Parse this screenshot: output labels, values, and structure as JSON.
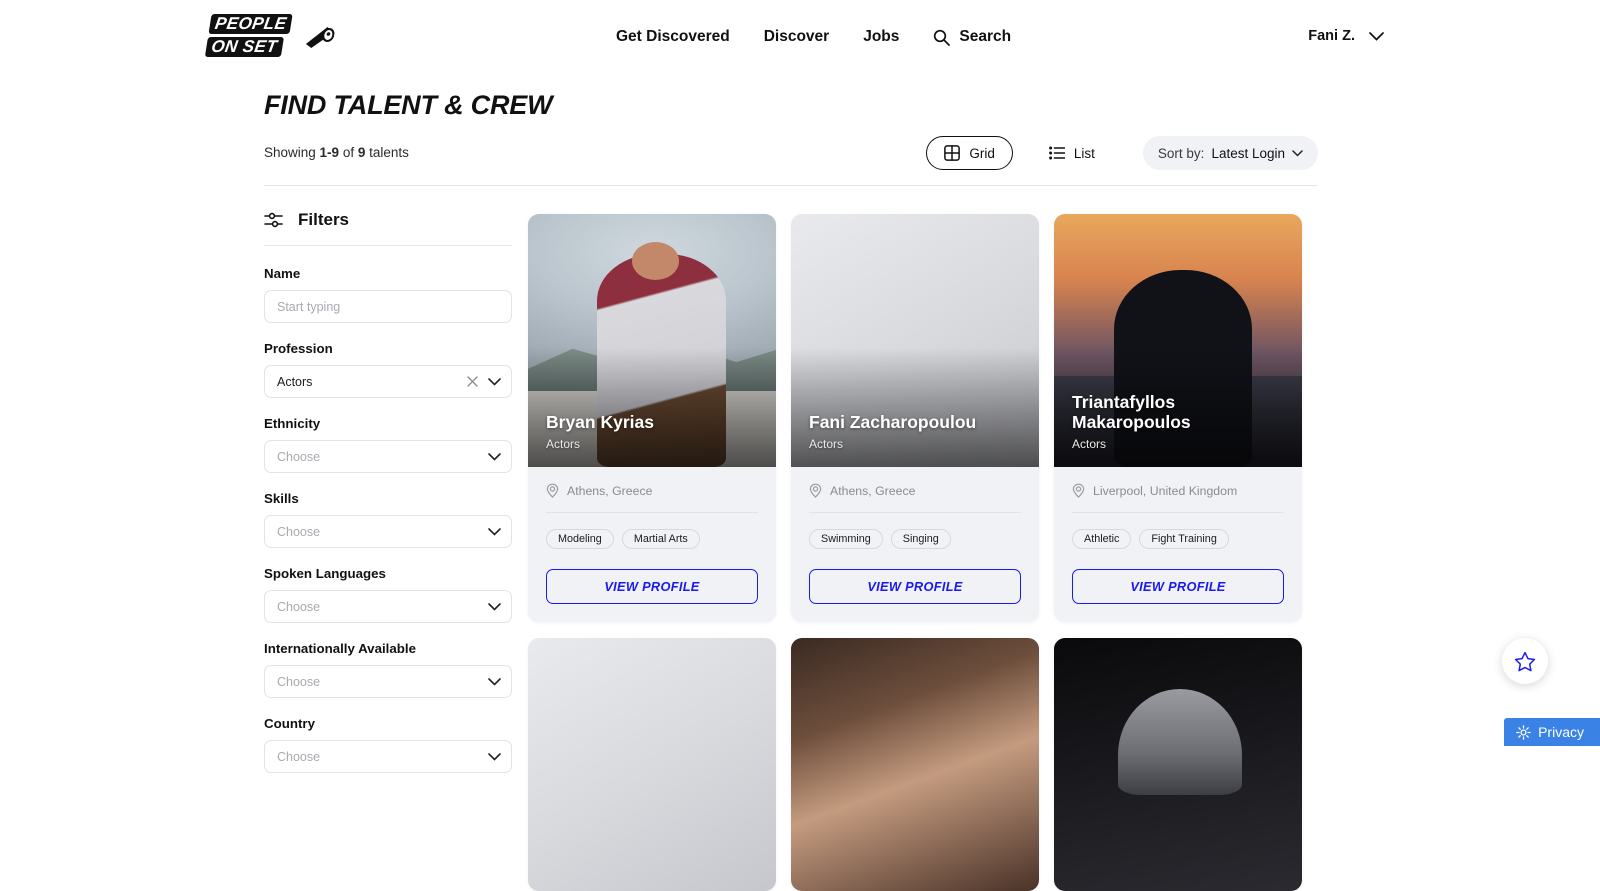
{
  "brand": {
    "logo_line1": "PEOPLE",
    "logo_line2": "ON SET",
    "camera_icon": "film-reel-icon"
  },
  "nav": {
    "items": [
      {
        "label": "Get Discovered"
      },
      {
        "label": "Discover"
      },
      {
        "label": "Jobs"
      }
    ],
    "search_label": "Search",
    "search_icon": "search-icon"
  },
  "user": {
    "name": "Fani Z.",
    "chevron_icon": "chevron-down-icon"
  },
  "page": {
    "title": "FIND TALENT & CREW"
  },
  "results": {
    "showing_prefix": "Showing ",
    "range": "1-9",
    "middle": " of ",
    "total": "9",
    "suffix": " talents"
  },
  "toolbar": {
    "grid_label": "Grid",
    "grid_icon": "grid-icon",
    "list_label": "List",
    "list_icon": "list-icon",
    "sort_label": "Sort by:",
    "sort_value": "Latest Login",
    "sort_chevron_icon": "chevron-down-icon"
  },
  "filters": {
    "heading": "Filters",
    "heading_icon": "sliders-icon",
    "fields": [
      {
        "label": "Name",
        "value": "",
        "placeholder": "Start typing",
        "type": "text",
        "clearable": false
      },
      {
        "label": "Profession",
        "value": "Actors",
        "placeholder": "",
        "type": "select",
        "clearable": true
      },
      {
        "label": "Ethnicity",
        "value": "",
        "placeholder": "Choose",
        "type": "select",
        "clearable": false
      },
      {
        "label": "Skills",
        "value": "",
        "placeholder": "Choose",
        "type": "select",
        "clearable": false
      },
      {
        "label": "Spoken Languages",
        "value": "",
        "placeholder": "Choose",
        "type": "select",
        "clearable": false
      },
      {
        "label": "Internationally Available",
        "value": "",
        "placeholder": "Choose",
        "type": "select",
        "clearable": false
      },
      {
        "label": "Country",
        "value": "",
        "placeholder": "Choose",
        "type": "select",
        "clearable": false
      }
    ]
  },
  "cards": [
    {
      "name": "Bryan Kyrias",
      "role": "Actors",
      "location": "Athens, Greece",
      "location_icon": "location-pin-icon",
      "tags": [
        "Modeling",
        "Martial Arts"
      ],
      "cta": "VIEW PROFILE",
      "photo": "man-sunglasses-outdoors"
    },
    {
      "name": "Fani Zacharopoulou",
      "role": "Actors",
      "location": "Athens, Greece",
      "location_icon": "location-pin-icon",
      "tags": [
        "Swimming",
        "Singing"
      ],
      "cta": "VIEW PROFILE",
      "photo": "gray-placeholder"
    },
    {
      "name": "Triantafyllos Makaropoulos",
      "role": "Actors",
      "location": "Liverpool, United Kingdom",
      "location_icon": "location-pin-icon",
      "tags": [
        "Athletic",
        "Fight Training"
      ],
      "cta": "VIEW PROFILE",
      "photo": "hooded-figure-sunset"
    }
  ],
  "floating": {
    "favorites_icon": "star-icon",
    "privacy_label": "Privacy",
    "privacy_icon": "gear-icon"
  },
  "colors": {
    "accent_blue": "#1a1aea",
    "privacy_blue": "#3b82e6",
    "card_bg": "#f1f2f6",
    "text_dark": "#111111",
    "text_muted": "#8a8a92"
  }
}
